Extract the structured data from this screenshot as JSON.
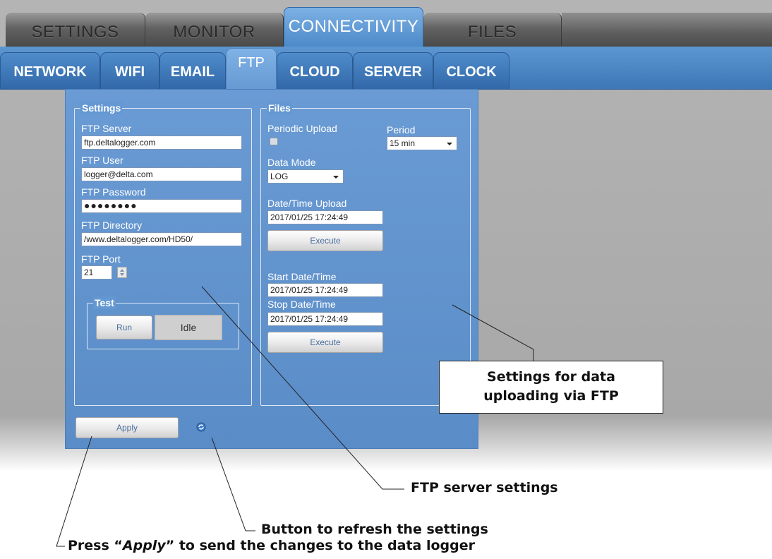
{
  "main_tabs": [
    {
      "label": "SETTINGS"
    },
    {
      "label": "MONITOR"
    },
    {
      "label": "CONNECTIVITY",
      "active": true
    },
    {
      "label": "FILES"
    }
  ],
  "sub_tabs": [
    {
      "label": "NETWORK"
    },
    {
      "label": "WIFI"
    },
    {
      "label": "EMAIL"
    },
    {
      "label": "FTP",
      "active": true
    },
    {
      "label": "CLOUD"
    },
    {
      "label": "SERVER"
    },
    {
      "label": "CLOCK"
    }
  ],
  "settings": {
    "legend": "Settings",
    "ftp_server_label": "FTP Server",
    "ftp_server_value": "ftp.deltalogger.com",
    "ftp_user_label": "FTP User",
    "ftp_user_value": "logger@delta.com",
    "ftp_password_label": "FTP Password",
    "ftp_password_value": "●●●●●●●●",
    "ftp_directory_label": "FTP Directory",
    "ftp_directory_value": "/www.deltalogger.com/HD50/",
    "ftp_port_label": "FTP Port",
    "ftp_port_value": "21",
    "test": {
      "legend": "Test",
      "run_label": "Run",
      "status": "Idle"
    }
  },
  "files": {
    "legend": "Files",
    "periodic_upload_label": "Periodic Upload",
    "periodic_upload_checked": false,
    "period_label": "Period",
    "period_value": "15 min",
    "data_mode_label": "Data Mode",
    "data_mode_value": "LOG",
    "datetime_upload_label": "Date/Time Upload",
    "datetime_upload_value": "2017/01/25 17:24:49",
    "execute_label": "Execute",
    "start_label": "Start Date/Time",
    "start_value": "2017/01/25 17:24:49",
    "stop_label": "Stop Date/Time",
    "stop_value": "2017/01/25 17:24:49",
    "execute2_label": "Execute"
  },
  "apply_label": "Apply",
  "icons": {
    "refresh": "refresh-icon"
  },
  "annotations": {
    "callout_line1": "Settings for data",
    "callout_line2": "uploading via FTP",
    "ftp_server_settings": "FTP server settings",
    "refresh_button": "Button to refresh the settings",
    "apply_prefix": "Press “",
    "apply_word": "Apply",
    "apply_suffix": "” to send the changes to the data logger"
  },
  "colors": {
    "accent_blue": "#4d8ac9",
    "panel_blue": "#6a9bd4",
    "tab_gray": "#626262"
  }
}
